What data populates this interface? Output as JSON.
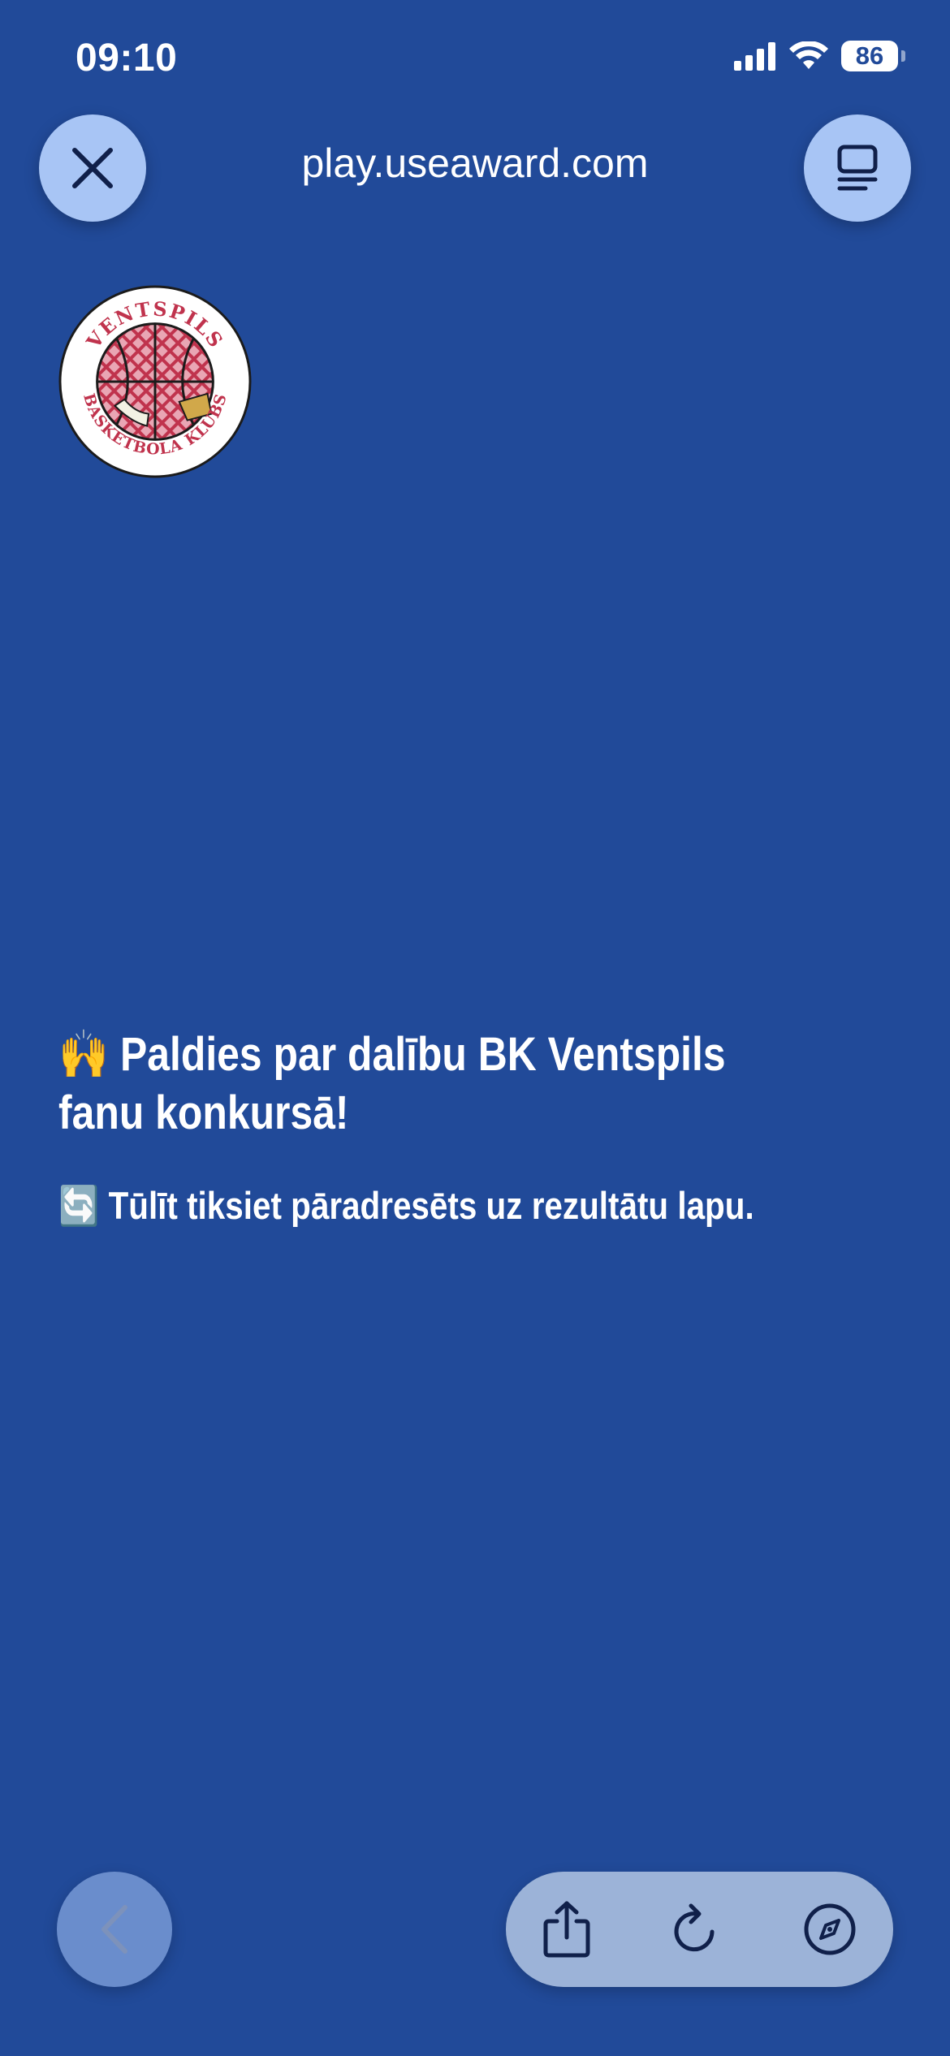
{
  "status_bar": {
    "time": "09:10",
    "battery": "86",
    "icons": [
      "cellular-signal-icon",
      "wifi-icon",
      "battery-icon"
    ]
  },
  "browser": {
    "url": "play.useaward.com",
    "close_icon": "close-icon",
    "reader_icon": "page-menu-icon"
  },
  "logo": {
    "top_text": "VENTSPILS",
    "bottom_text": "BASKETBOLA KLUBS"
  },
  "content": {
    "headline_emoji": "🙌",
    "headline": "Paldies par dalību BK Ventspils fanu konkursā!",
    "subline_emoji": "🔄",
    "subline": "Tūlīt tiksiet pāradresēts uz rezultātu lapu."
  },
  "toolbar": {
    "icons": [
      "back-icon",
      "share-icon",
      "reload-icon",
      "compass-icon"
    ]
  },
  "colors": {
    "background": "#214a99",
    "button": "#a8c5f5",
    "toolbar_pill": "#9cb3d8",
    "logo_accent": "#c0334d"
  }
}
